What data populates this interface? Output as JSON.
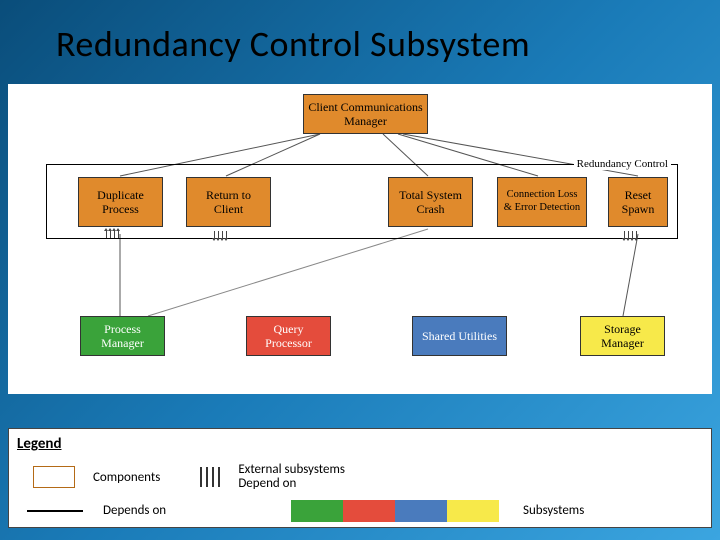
{
  "title": "Redundancy Control Subsystem",
  "nodes": {
    "client_comm_mgr": "Client Communications Manager",
    "redundancy_control": "Redundancy Control",
    "duplicate_process": "Duplicate Process",
    "return_to_client": "Return to Client",
    "total_system_crash": "Total System Crash",
    "conn_loss_error": "Connection Loss & Error Detection",
    "reset_spawn": "Reset Spawn",
    "process_manager": "Process Manager",
    "query_processor": "Query Processor",
    "shared_utilities": "Shared Utilities",
    "storage_manager": "Storage Manager"
  },
  "legend": {
    "title": "Legend",
    "components": "Components",
    "depends_on": "Depends on",
    "external": "External subsystems Depend on",
    "subsystems": "Subsystems"
  },
  "colors": {
    "orange": "#e08a2c",
    "green": "#3aa33a",
    "red": "#e44c3c",
    "blue": "#4a7bbd",
    "yellow": "#f7e94a"
  },
  "chart_data": {
    "type": "diagram",
    "title": "Redundancy Control Subsystem",
    "nodes": [
      {
        "id": "client_comm_mgr",
        "label": "Client Communications Manager",
        "color": "orange",
        "group": "external"
      },
      {
        "id": "redundancy_control",
        "label": "Redundancy Control",
        "type": "container"
      },
      {
        "id": "duplicate_process",
        "label": "Duplicate Process",
        "color": "orange",
        "group": "redundancy_control"
      },
      {
        "id": "return_to_client",
        "label": "Return to Client",
        "color": "orange",
        "group": "redundancy_control"
      },
      {
        "id": "total_system_crash",
        "label": "Total System Crash",
        "color": "orange",
        "group": "redundancy_control"
      },
      {
        "id": "conn_loss_error",
        "label": "Connection Loss & Error Detection",
        "color": "orange",
        "group": "redundancy_control"
      },
      {
        "id": "reset_spawn",
        "label": "Reset Spawn",
        "color": "orange",
        "group": "redundancy_control"
      },
      {
        "id": "process_manager",
        "label": "Process Manager",
        "color": "green",
        "group": "subsystem"
      },
      {
        "id": "query_processor",
        "label": "Query Processor",
        "color": "red",
        "group": "subsystem"
      },
      {
        "id": "shared_utilities",
        "label": "Shared Utilities",
        "color": "blue",
        "group": "subsystem"
      },
      {
        "id": "storage_manager",
        "label": "Storage Manager",
        "color": "yellow",
        "group": "subsystem"
      }
    ],
    "edges": [
      {
        "from": "client_comm_mgr",
        "to": "duplicate_process"
      },
      {
        "from": "client_comm_mgr",
        "to": "return_to_client"
      },
      {
        "from": "client_comm_mgr",
        "to": "total_system_crash"
      },
      {
        "from": "client_comm_mgr",
        "to": "conn_loss_error"
      },
      {
        "from": "client_comm_mgr",
        "to": "reset_spawn"
      },
      {
        "from": "duplicate_process",
        "to": "process_manager"
      },
      {
        "from": "total_system_crash",
        "to": "process_manager",
        "style": "external_ticks"
      },
      {
        "from": "reset_spawn",
        "to": "storage_manager"
      }
    ],
    "external_depend_ticks": [
      "duplicate_process",
      "return_to_client",
      "reset_spawn"
    ]
  }
}
